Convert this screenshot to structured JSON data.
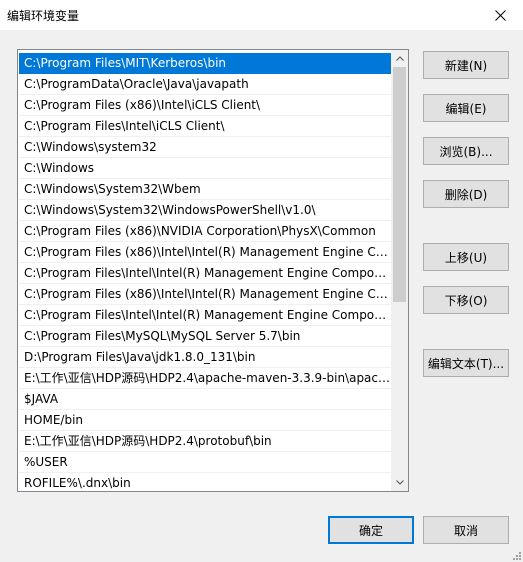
{
  "window": {
    "title": "编辑环境变量",
    "close_glyph": "close-icon"
  },
  "path_list": {
    "selected_index": 0,
    "items": [
      "C:\\Program Files\\MIT\\Kerberos\\bin",
      "C:\\ProgramData\\Oracle\\Java\\javapath",
      "C:\\Program Files (x86)\\Intel\\iCLS Client\\",
      "C:\\Program Files\\Intel\\iCLS Client\\",
      "C:\\Windows\\system32",
      "C:\\Windows",
      "C:\\Windows\\System32\\Wbem",
      "C:\\Windows\\System32\\WindowsPowerShell\\v1.0\\",
      "C:\\Program Files (x86)\\NVIDIA Corporation\\PhysX\\Common",
      "C:\\Program Files (x86)\\Intel\\Intel(R) Management Engine Co...",
      "C:\\Program Files\\Intel\\Intel(R) Management Engine Compon...",
      "C:\\Program Files (x86)\\Intel\\Intel(R) Management Engine Co...",
      "C:\\Program Files\\Intel\\Intel(R) Management Engine Compon...",
      "C:\\Program Files\\MySQL\\MySQL Server 5.7\\bin",
      "D:\\Program Files\\Java\\jdk1.8.0_131\\bin",
      "E:\\工作\\亚信\\HDP源码\\HDP2.4\\apache-maven-3.3.9-bin\\apach...",
      "$JAVA",
      "HOME/bin",
      "E:\\工作\\亚信\\HDP源码\\HDP2.4\\protobuf\\bin",
      "%USER",
      "ROFILE%\\.dnx\\bin"
    ]
  },
  "side_buttons": {
    "new": "新建(N)",
    "edit": "编辑(E)",
    "browse": "浏览(B)...",
    "delete": "删除(D)",
    "move_up": "上移(U)",
    "move_down": "下移(O)",
    "edit_text": "编辑文本(T)..."
  },
  "footer": {
    "ok": "确定",
    "cancel": "取消"
  },
  "colors": {
    "selection": "#0078d7",
    "button_face": "#e1e1e1",
    "dialog_bg": "#f0f0f0"
  }
}
